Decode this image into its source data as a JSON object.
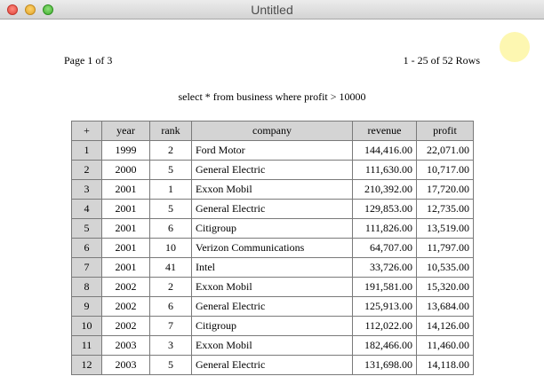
{
  "window": {
    "title": "Untitled"
  },
  "pagination": {
    "page_label": "Page 1 of 3",
    "rows_label": "1 - 25 of 52 Rows"
  },
  "query": "select * from business where profit > 10000",
  "table": {
    "headers": [
      "+",
      "year",
      "rank",
      "company",
      "revenue",
      "profit"
    ],
    "rows": [
      [
        "1",
        "1999",
        "2",
        "Ford Motor",
        "144,416.00",
        "22,071.00"
      ],
      [
        "2",
        "2000",
        "5",
        "General Electric",
        "111,630.00",
        "10,717.00"
      ],
      [
        "3",
        "2001",
        "1",
        "Exxon Mobil",
        "210,392.00",
        "17,720.00"
      ],
      [
        "4",
        "2001",
        "5",
        "General Electric",
        "129,853.00",
        "12,735.00"
      ],
      [
        "5",
        "2001",
        "6",
        "Citigroup",
        "111,826.00",
        "13,519.00"
      ],
      [
        "6",
        "2001",
        "10",
        "Verizon Communications",
        "64,707.00",
        "11,797.00"
      ],
      [
        "7",
        "2001",
        "41",
        "Intel",
        "33,726.00",
        "10,535.00"
      ],
      [
        "8",
        "2002",
        "2",
        "Exxon Mobil",
        "191,581.00",
        "15,320.00"
      ],
      [
        "9",
        "2002",
        "6",
        "General Electric",
        "125,913.00",
        "13,684.00"
      ],
      [
        "10",
        "2002",
        "7",
        "Citigroup",
        "112,022.00",
        "14,126.00"
      ],
      [
        "11",
        "2003",
        "3",
        "Exxon Mobil",
        "182,466.00",
        "11,460.00"
      ],
      [
        "12",
        "2003",
        "5",
        "General Electric",
        "131,698.00",
        "14,118.00"
      ]
    ]
  }
}
